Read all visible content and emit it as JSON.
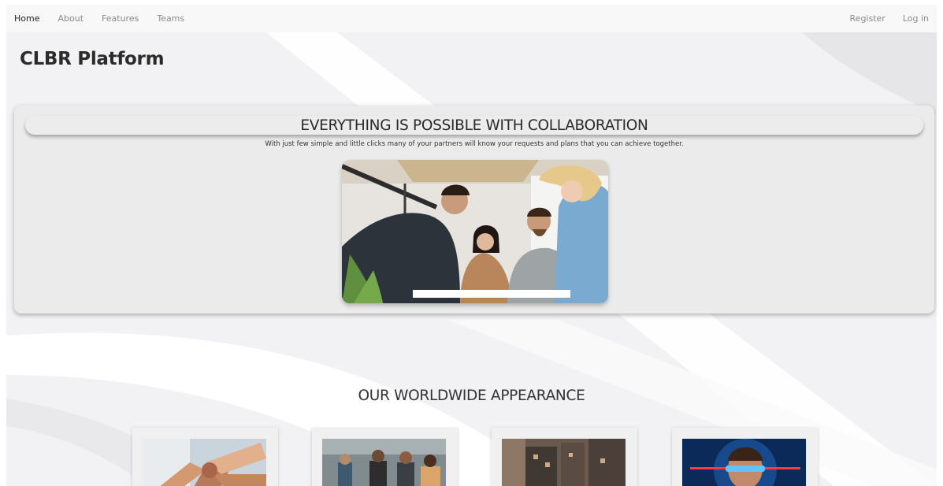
{
  "nav": {
    "left": [
      {
        "label": "Home",
        "active": true
      },
      {
        "label": "About",
        "active": false
      },
      {
        "label": "Features",
        "active": false
      },
      {
        "label": "Teams",
        "active": false
      }
    ],
    "right": [
      {
        "label": "Register"
      },
      {
        "label": "Log in"
      }
    ]
  },
  "brand": "CLBR Platform",
  "hero": {
    "title": "EVERYTHING IS POSSIBLE WITH COLLABORATION",
    "subtitle": "With just few simple and little clicks many of your partners will know your requests and plans that you can achieve together."
  },
  "section": {
    "title": "OUR WORLDWIDE APPEARANCE"
  },
  "colors": {
    "page_bg": "#f1f1f3",
    "card_bg": "#ebebeb",
    "nav_bg": "#f8f8f9"
  }
}
